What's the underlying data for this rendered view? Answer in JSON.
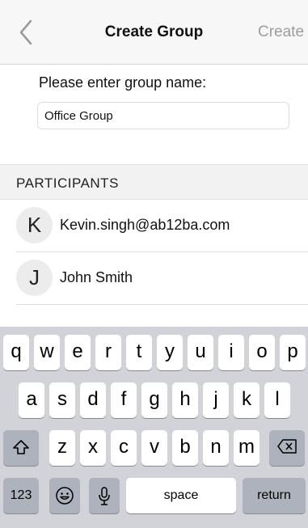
{
  "navbar": {
    "back_icon": "chevron-left-icon",
    "title": "Create Group",
    "action_label": "Create"
  },
  "form": {
    "label": "Please enter group name:",
    "group_name_value": "Office Group"
  },
  "participants": {
    "section_title": "PARTICIPANTS",
    "items": [
      {
        "initial": "K",
        "name": "Kevin.singh@ab12ba.com"
      },
      {
        "initial": "J",
        "name": "John Smith"
      }
    ]
  },
  "keyboard": {
    "row1": [
      "q",
      "w",
      "e",
      "r",
      "t",
      "y",
      "u",
      "i",
      "o",
      "p"
    ],
    "row2": [
      "a",
      "s",
      "d",
      "f",
      "g",
      "h",
      "j",
      "k",
      "l"
    ],
    "row3": [
      "z",
      "x",
      "c",
      "v",
      "b",
      "n",
      "m"
    ],
    "shift_icon": "shift-icon",
    "delete_icon": "delete-backspace-icon",
    "numbers_label": "123",
    "emoji_icon": "emoji-icon",
    "mic_icon": "microphone-icon",
    "space_label": "space",
    "return_label": "return"
  },
  "colors": {
    "nav_action_disabled": "#9c9c9c",
    "keyboard_bg": "#d1d3d9",
    "key_dark": "#adb2bc"
  }
}
